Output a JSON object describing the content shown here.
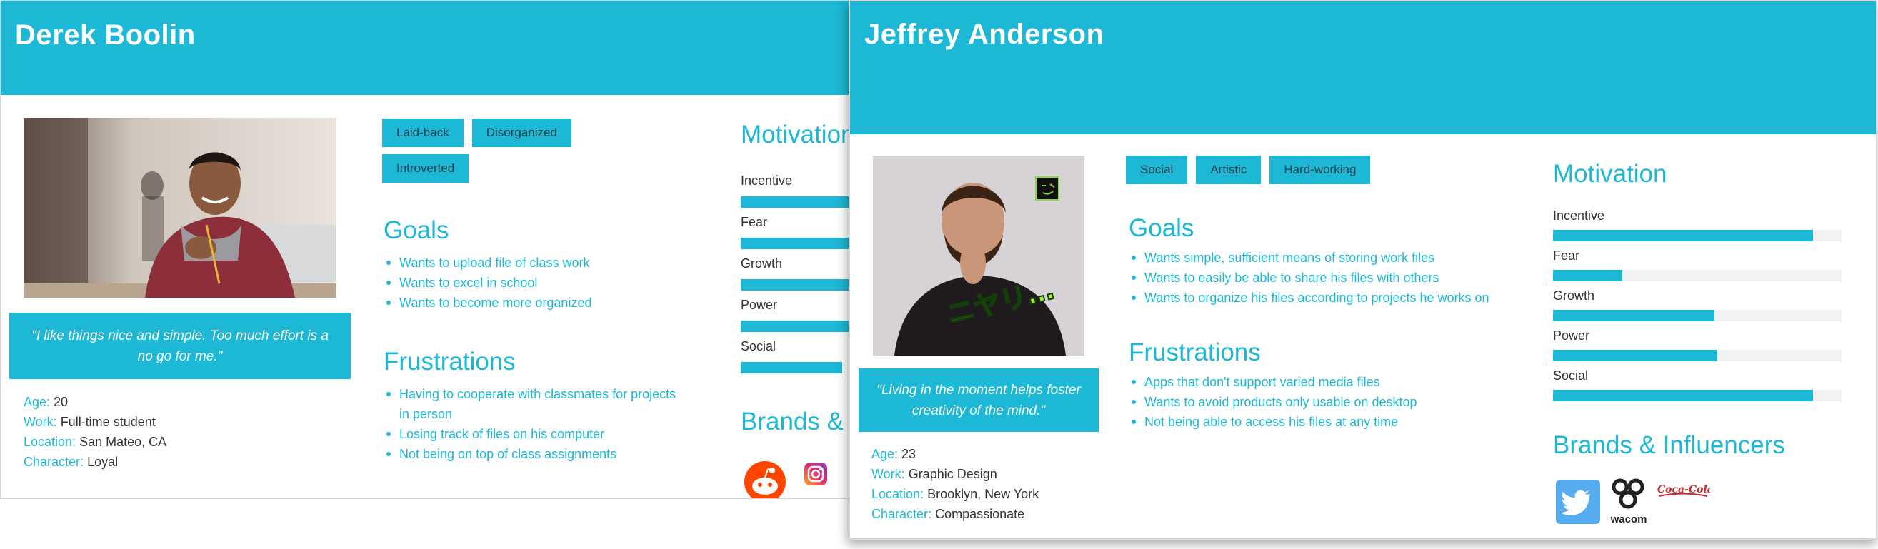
{
  "colors": {
    "accent": "#1cb8d5",
    "text": "#333333",
    "track": "#f2f2f2"
  },
  "persona_back": {
    "name": "Derek Boolin",
    "traits": [
      "Laid-back",
      "Disorganized",
      "Introverted"
    ],
    "quote": "\"I like things nice and simple. Too much effort is a no go for me.\"",
    "info": [
      {
        "key": "Age:",
        "value": "20"
      },
      {
        "key": "Work:",
        "value": "Full-time student"
      },
      {
        "key": "Location:",
        "value": "San Mateo, CA"
      },
      {
        "key": "Character:",
        "value": "Loyal"
      }
    ],
    "goals_title": "Goals",
    "goals": [
      "Wants to upload file of class work",
      "Wants to excel in school",
      "Wants to become more organized"
    ],
    "frustrations_title": "Frustrations",
    "frustrations": [
      "Having to cooperate with classmates for projects in person",
      "Losing track of files on his computer",
      "Not being on top of class assignments"
    ],
    "motivation_title": "Motivation",
    "motivation": [
      {
        "label": "Incentive"
      },
      {
        "label": "Fear"
      },
      {
        "label": "Growth"
      },
      {
        "label": "Power"
      },
      {
        "label": "Social"
      }
    ],
    "brands_title": "Brands & Influencers",
    "brands": [
      "reddit-icon",
      "instagram-icon"
    ]
  },
  "persona_front": {
    "name": "Jeffrey Anderson",
    "traits": [
      "Social",
      "Artistic",
      "Hard-working"
    ],
    "photo_caption": "ニヤリ…",
    "quote": "\"Living in the moment helps foster creativity of the mind.\"",
    "info": [
      {
        "key": "Age:",
        "value": "23"
      },
      {
        "key": "Work:",
        "value": "Graphic Design"
      },
      {
        "key": "Location:",
        "value": "Brooklyn, New York"
      },
      {
        "key": "Character:",
        "value": "Compassionate"
      }
    ],
    "goals_title": "Goals",
    "goals": [
      "Wants simple, sufficient means of storing work files",
      "Wants to easily be able to share his files with others",
      "Wants to organize his files according to projects he works on"
    ],
    "frustrations_title": "Frustrations",
    "frustrations": [
      "Apps that don't support varied media files",
      "Wants to avoid products only usable on desktop",
      "Not being able to access his files at any time"
    ],
    "motivation_title": "Motivation",
    "motivation": [
      {
        "label": "Incentive",
        "level": 0.9
      },
      {
        "label": "Fear",
        "level": 0.24
      },
      {
        "label": "Growth",
        "level": 0.56
      },
      {
        "label": "Power",
        "level": 0.57
      },
      {
        "label": "Social",
        "level": 0.9
      }
    ],
    "brands_title": "Brands & Influencers",
    "brands": [
      "twitter-icon",
      "wacom-icon",
      "coca-cola-icon"
    ],
    "brand_labels": {
      "wacom": "wacom",
      "coca_cola": "Coca-Cola"
    }
  }
}
